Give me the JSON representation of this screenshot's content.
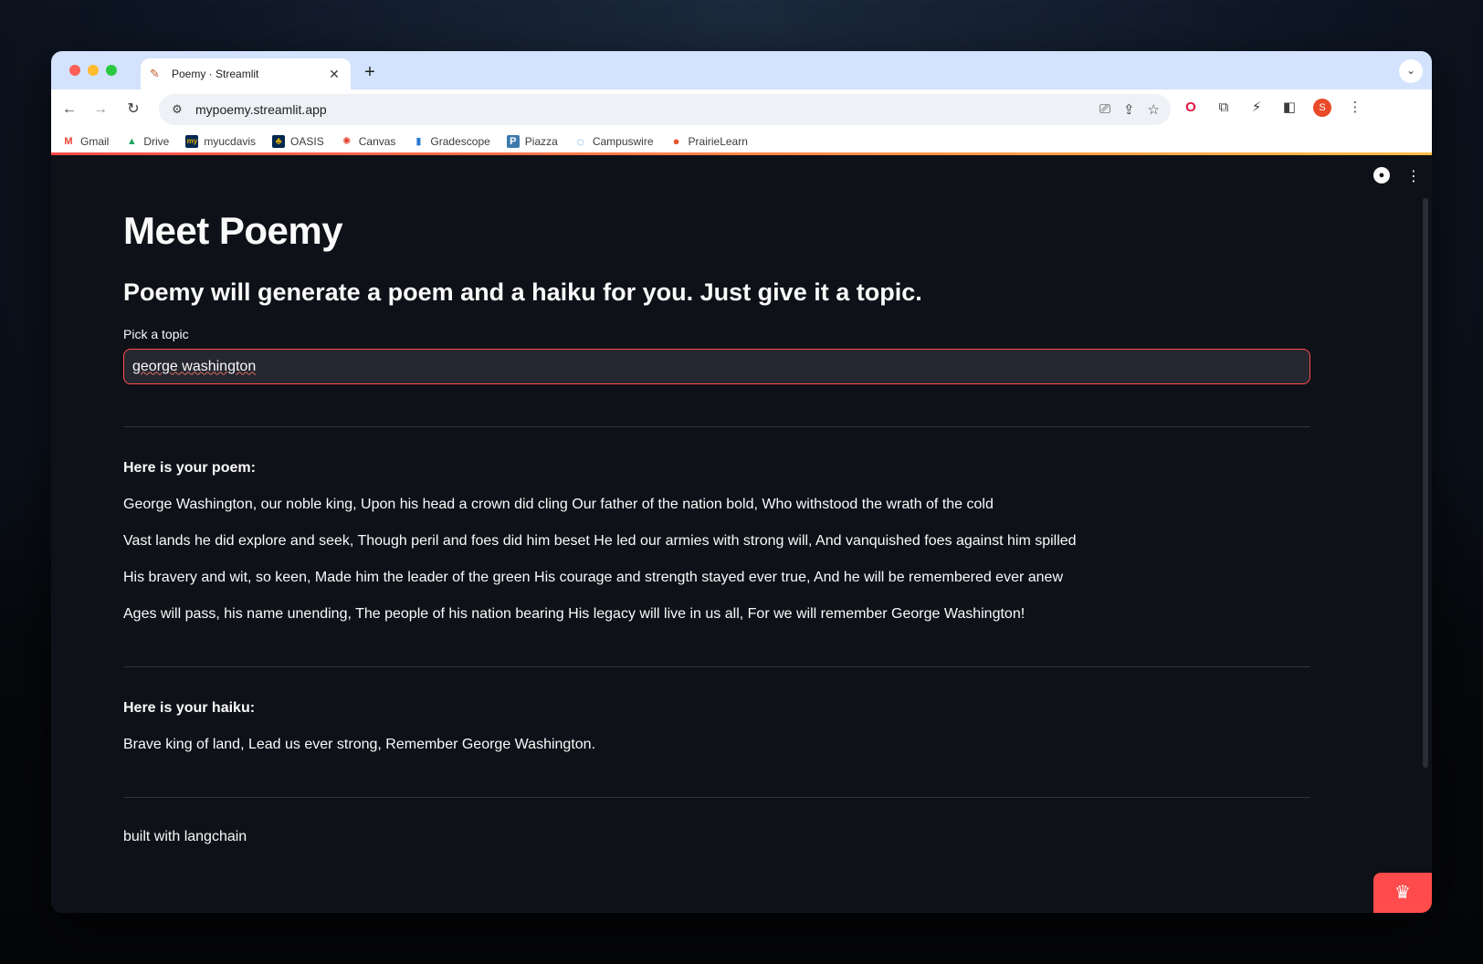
{
  "browser": {
    "tab_title": "Poemy · Streamlit",
    "url": "mypoemy.streamlit.app",
    "avatar_letter": "S",
    "bookmarks": [
      {
        "label": "Gmail",
        "icon": "gmail-icon",
        "glyph": "M",
        "color": "#ea4335"
      },
      {
        "label": "Drive",
        "icon": "drive-icon",
        "glyph": "▲",
        "color": "#1fa463"
      },
      {
        "label": "myucdavis",
        "icon": "myucdavis-icon",
        "glyph": "my",
        "color": "#022851"
      },
      {
        "label": "OASIS",
        "icon": "oasis-icon",
        "glyph": "♣",
        "color": "#daaa00"
      },
      {
        "label": "Canvas",
        "icon": "canvas-icon",
        "glyph": "✺",
        "color": "#e13f2b"
      },
      {
        "label": "Gradescope",
        "icon": "gradescope-icon",
        "glyph": "▮",
        "color": "#2a7ad5"
      },
      {
        "label": "Piazza",
        "icon": "piazza-icon",
        "glyph": "P",
        "color": "#3e7aab"
      },
      {
        "label": "Campuswire",
        "icon": "campuswire-icon",
        "glyph": "◌",
        "color": "#2c7be5"
      },
      {
        "label": "PrairieLearn",
        "icon": "prairielearn-icon",
        "glyph": "●",
        "color": "#e8552a"
      }
    ]
  },
  "app": {
    "title": "Meet Poemy",
    "subtitle": "Poemy will generate a poem and a haiku for you. Just give it a topic.",
    "input_label": "Pick a topic",
    "input_value": "george washington",
    "poem_heading": "Here is your poem:",
    "poem_lines": [
      "George Washington, our noble king, Upon his head a crown did cling Our father of the nation bold, Who withstood the wrath of the cold",
      "Vast lands he did explore and seek, Though peril and foes did him beset He led our armies with strong will, And vanquished foes against him spilled",
      "His bravery and wit, so keen, Made him the leader of the green His courage and strength stayed ever true, And he will be remembered ever anew",
      "Ages will pass, his name unending, The people of his nation bearing His legacy will live in us all, For we will remember George Washington!"
    ],
    "haiku_heading": "Here is your haiku:",
    "haiku_text": "Brave king of land, Lead us ever strong, Remember George Washington.",
    "footer": "built with langchain"
  }
}
